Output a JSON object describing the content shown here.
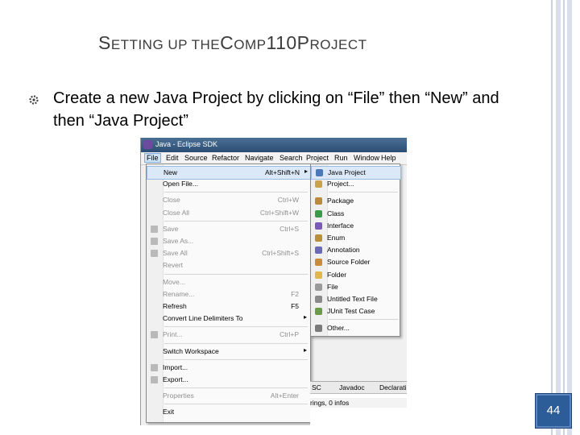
{
  "slide": {
    "title_parts": [
      "S",
      "ETTING UP THE ",
      "C",
      "OMP",
      "110 ",
      "P",
      "ROJECT"
    ],
    "bullet_text": "Create a new Java Project by clicking on “File” then “New” and then “Java Project”",
    "bullet_icon": "gear-bullet-icon",
    "page_number": "44",
    "colors": {
      "title": "#3c3c3c",
      "page_badge": "#2c5d98",
      "menu_highlight": "#dbe8f7"
    }
  },
  "screenshot": {
    "window_title": "Java - Eclipse SDK",
    "menubar": [
      "File",
      "Edit",
      "Source",
      "Refactor",
      "Navigate",
      "Search",
      "Project",
      "Run",
      "Window",
      "Help"
    ],
    "file_menu": [
      {
        "label": "New",
        "accel": "Alt+Shift+N",
        "submenu": true,
        "highlight": true
      },
      {
        "label": "Open File...",
        "accel": ""
      },
      {
        "sep": true
      },
      {
        "label": "Close",
        "accel": "Ctrl+W",
        "disabled": true
      },
      {
        "label": "Close All",
        "accel": "Ctrl+Shift+W",
        "disabled": true
      },
      {
        "sep": true
      },
      {
        "label": "Save",
        "accel": "Ctrl+S",
        "disabled": true,
        "icon": "save-icon"
      },
      {
        "label": "Save As...",
        "accel": "",
        "disabled": true,
        "icon": "save-as-icon"
      },
      {
        "label": "Save All",
        "accel": "Ctrl+Shift+S",
        "disabled": true,
        "icon": "save-all-icon"
      },
      {
        "label": "Revert",
        "accel": "",
        "disabled": true
      },
      {
        "sep": true
      },
      {
        "label": "Move...",
        "accel": "",
        "disabled": true
      },
      {
        "label": "Rename...",
        "accel": "F2",
        "disabled": true
      },
      {
        "label": "Refresh",
        "accel": "F5"
      },
      {
        "label": "Convert Line Delimiters To",
        "accel": "",
        "submenu": true
      },
      {
        "sep": true
      },
      {
        "label": "Print...",
        "accel": "Ctrl+P",
        "disabled": true,
        "icon": "print-icon"
      },
      {
        "sep": true
      },
      {
        "label": "Switch Workspace",
        "accel": "",
        "submenu": true
      },
      {
        "sep": true
      },
      {
        "label": "Import...",
        "accel": "",
        "icon": "import-icon"
      },
      {
        "label": "Export...",
        "accel": "",
        "icon": "export-icon"
      },
      {
        "sep": true
      },
      {
        "label": "Properties",
        "accel": "Alt+Enter",
        "disabled": true
      },
      {
        "sep": true
      },
      {
        "label": "Exit",
        "accel": ""
      }
    ],
    "new_submenu": [
      {
        "label": "Java Project",
        "icon": "java-project-icon",
        "highlight": true,
        "color": "#4a78b8"
      },
      {
        "label": "Project...",
        "icon": "project-icon",
        "color": "#c9a24a"
      },
      {
        "sep": true
      },
      {
        "label": "Package",
        "icon": "package-icon",
        "color": "#b88a3a"
      },
      {
        "label": "Class",
        "icon": "class-icon",
        "color": "#3a9a4a"
      },
      {
        "label": "Interface",
        "icon": "interface-icon",
        "color": "#7a5ab8"
      },
      {
        "label": "Enum",
        "icon": "enum-icon",
        "color": "#b8903a"
      },
      {
        "label": "Annotation",
        "icon": "annotation-icon",
        "color": "#6a6ab8"
      },
      {
        "label": "Source Folder",
        "icon": "source-folder-icon",
        "color": "#c98a3a"
      },
      {
        "label": "Folder",
        "icon": "folder-icon",
        "color": "#e0b84a"
      },
      {
        "label": "File",
        "icon": "file-icon",
        "color": "#9a9a9a"
      },
      {
        "label": "Untitled Text File",
        "icon": "text-file-icon",
        "color": "#8a8a8a"
      },
      {
        "label": "JUnit Test Case",
        "icon": "junit-icon",
        "color": "#6a9a4a"
      },
      {
        "sep": true
      },
      {
        "label": "Other...",
        "icon": "other-icon",
        "color": "#7a7a7a"
      }
    ],
    "bottom_tabs": [
      "SC",
      "Javadoc",
      "Declarati"
    ],
    "status_text": "rings, 0 infos"
  }
}
